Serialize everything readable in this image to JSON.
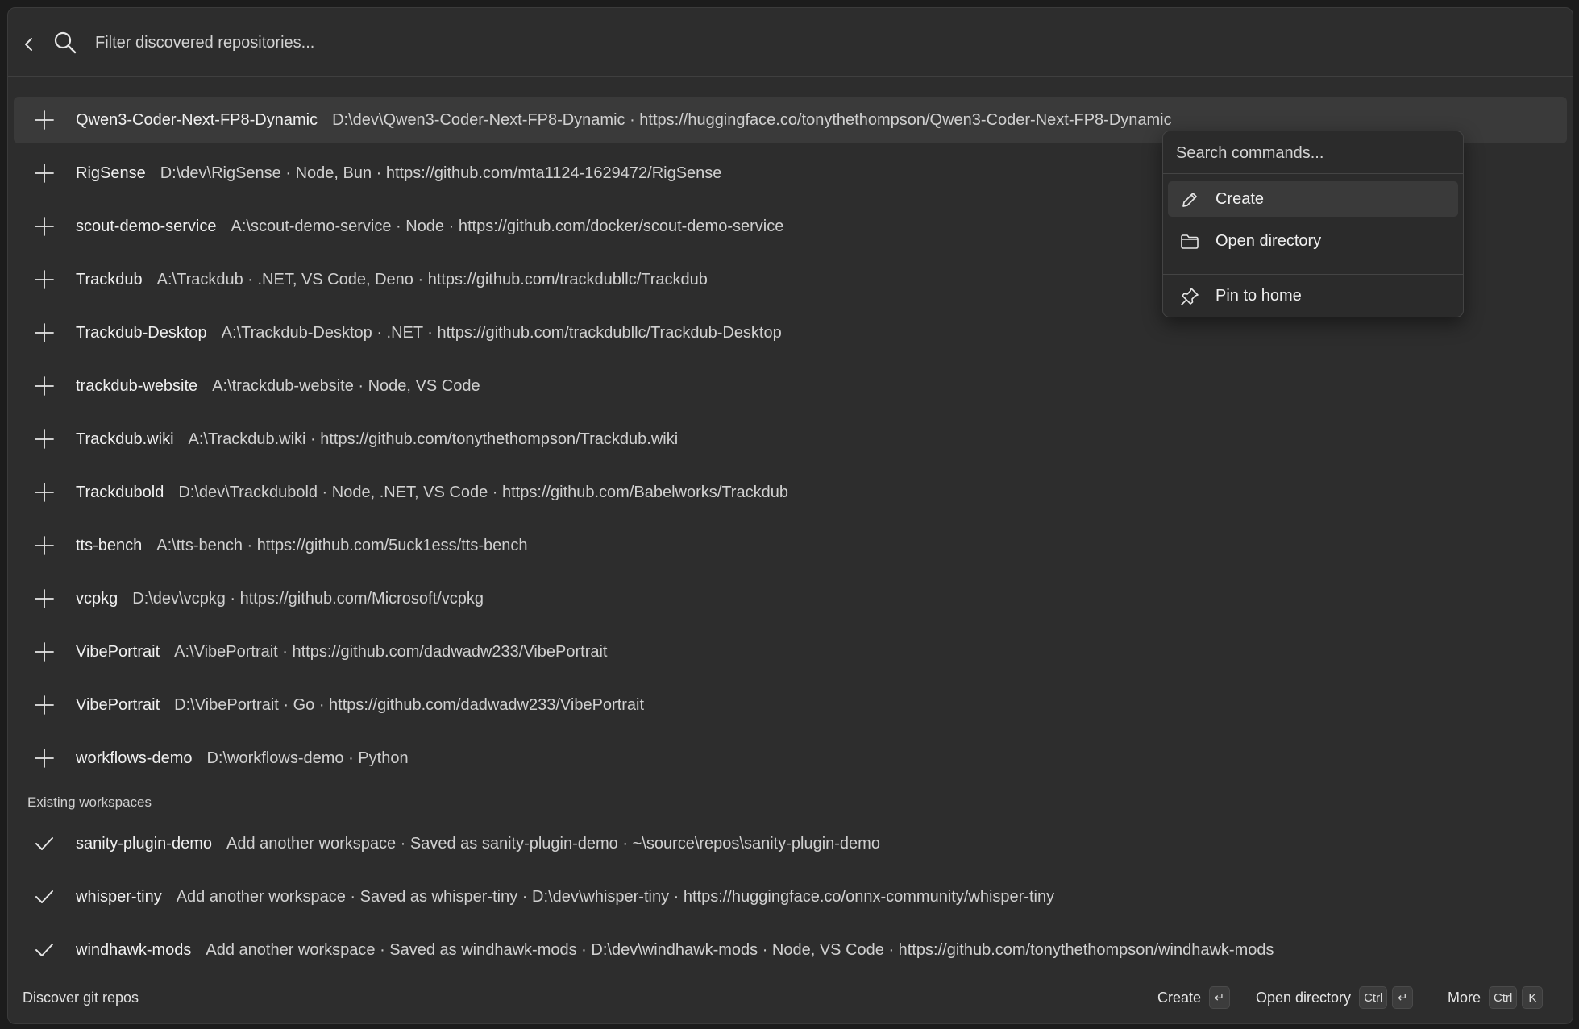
{
  "search": {
    "placeholder": "Filter discovered repositories..."
  },
  "discovered": [
    {
      "name": "Qwen3-Coder-Next-FP8-Dynamic",
      "desc": "D:\\dev\\Qwen3-Coder-Next-FP8-Dynamic · https://huggingface.co/tonythethompson/Qwen3-Coder-Next-FP8-Dynamic",
      "icon": "plus-icon"
    },
    {
      "name": "RigSense",
      "desc": "D:\\dev\\RigSense · Node, Bun · https://github.com/mta1124-1629472/RigSense",
      "icon": "plus-icon"
    },
    {
      "name": "scout-demo-service",
      "desc": "A:\\scout-demo-service · Node · https://github.com/docker/scout-demo-service",
      "icon": "plus-icon"
    },
    {
      "name": "Trackdub",
      "desc": "A:\\Trackdub · .NET, VS Code, Deno · https://github.com/trackdubllc/Trackdub",
      "icon": "plus-icon"
    },
    {
      "name": "Trackdub-Desktop",
      "desc": "A:\\Trackdub-Desktop · .NET · https://github.com/trackdubllc/Trackdub-Desktop",
      "icon": "plus-icon"
    },
    {
      "name": "trackdub-website",
      "desc": "A:\\trackdub-website · Node, VS Code",
      "icon": "plus-icon"
    },
    {
      "name": "Trackdub.wiki",
      "desc": "A:\\Trackdub.wiki · https://github.com/tonythethompson/Trackdub.wiki",
      "icon": "plus-icon"
    },
    {
      "name": "Trackdubold",
      "desc": "D:\\dev\\Trackdubold · Node, .NET, VS Code · https://github.com/Babelworks/Trackdub",
      "icon": "plus-icon"
    },
    {
      "name": "tts-bench",
      "desc": "A:\\tts-bench · https://github.com/5uck1ess/tts-bench",
      "icon": "plus-icon"
    },
    {
      "name": "vcpkg",
      "desc": "D:\\dev\\vcpkg · https://github.com/Microsoft/vcpkg",
      "icon": "plus-icon"
    },
    {
      "name": "VibePortrait",
      "desc": "A:\\VibePortrait · https://github.com/dadwadw233/VibePortrait",
      "icon": "plus-icon"
    },
    {
      "name": "VibePortrait",
      "desc": "D:\\VibePortrait · Go · https://github.com/dadwadw233/VibePortrait",
      "icon": "plus-icon"
    },
    {
      "name": "workflows-demo",
      "desc": "D:\\workflows-demo · Python",
      "icon": "plus-icon"
    }
  ],
  "existing_header": "Existing workspaces",
  "existing": [
    {
      "name": "sanity-plugin-demo",
      "desc": "Add another workspace · Saved as sanity-plugin-demo · ~\\source\\repos\\sanity-plugin-demo",
      "icon": "check-icon"
    },
    {
      "name": "whisper-tiny",
      "desc": "Add another workspace · Saved as whisper-tiny · D:\\dev\\whisper-tiny · https://huggingface.co/onnx-community/whisper-tiny",
      "icon": "check-icon"
    },
    {
      "name": "windhawk-mods",
      "desc": "Add another workspace · Saved as windhawk-mods · D:\\dev\\windhawk-mods · Node, VS Code · https://github.com/tonythethompson/windhawk-mods",
      "icon": "check-icon"
    }
  ],
  "commands": {
    "placeholder": "Search commands...",
    "items": [
      {
        "label": "Create",
        "icon": "pencil-icon"
      },
      {
        "label": "Open directory",
        "icon": "folder-icon"
      },
      {
        "label": "Pin to home",
        "icon": "pin-icon"
      }
    ]
  },
  "footer": {
    "title": "Discover git repos",
    "actions": [
      {
        "label": "Create",
        "keys": [
          "↵"
        ]
      },
      {
        "label": "Open directory",
        "keys": [
          "Ctrl",
          "↵"
        ]
      },
      {
        "label": "More",
        "keys": [
          "Ctrl",
          "K"
        ]
      }
    ]
  },
  "colors": {
    "background": "#2d2d2d",
    "selected_row": "#3a3a3a",
    "text": "#e6e6e6"
  }
}
